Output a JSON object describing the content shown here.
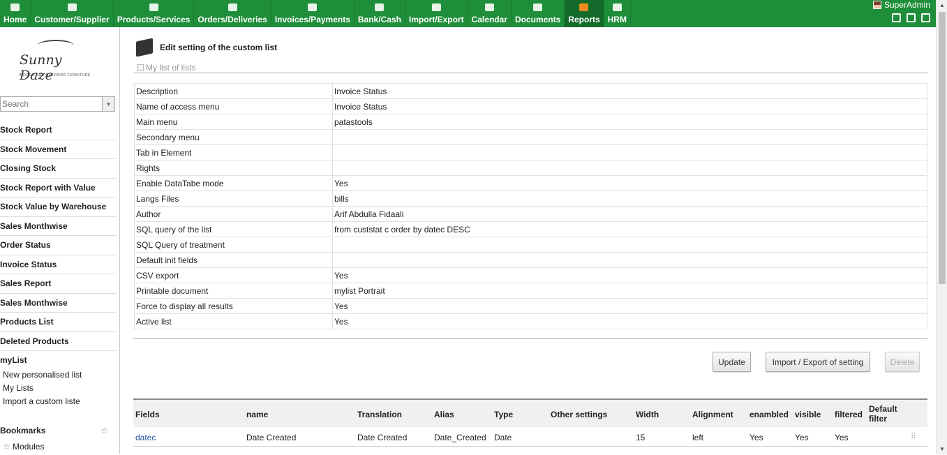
{
  "menu": [
    {
      "label": "Home",
      "icon": "home-icon"
    },
    {
      "label": "Customer/Supplier",
      "icon": "company-icon"
    },
    {
      "label": "Products/Services",
      "icon": "products-icon"
    },
    {
      "label": "Orders/Deliveries",
      "icon": "orders-icon"
    },
    {
      "label": "Invoices/Payments",
      "icon": "invoices-icon"
    },
    {
      "label": "Bank/Cash",
      "icon": "bank-icon"
    },
    {
      "label": "Import/Export",
      "icon": "tools-icon"
    },
    {
      "label": "Calendar",
      "icon": "calendar-icon"
    },
    {
      "label": "Documents",
      "icon": "documents-icon"
    },
    {
      "label": "Reports",
      "icon": "reports-icon",
      "active": true
    },
    {
      "label": "HRM",
      "icon": "hrm-icon"
    }
  ],
  "user": {
    "name": "SuperAdmin"
  },
  "colors": {
    "topbar": "#1f8e3a",
    "active": "#146a2a",
    "link": "#1a4f9c"
  },
  "logo": {
    "text": "Sunny Daze",
    "sub": "INDOOR AND OUTDOOR FURNITURE"
  },
  "search": {
    "placeholder": "Search"
  },
  "sidebar": {
    "items": [
      "Stock Report",
      "Stock Movement",
      "Closing Stock",
      "Stock Report with Value",
      "Stock Value by Warehouse",
      "Sales Monthwise",
      "Order Status",
      "Invoice Status",
      "Sales Report",
      "Sales Monthwise",
      "Products List",
      "Deleted Products"
    ],
    "mylist": {
      "title": "myList",
      "links": [
        "New personalised list",
        "My Lists",
        "Import a custom liste"
      ]
    },
    "bookmarks": {
      "title": "Bookmarks",
      "modules": "Modules"
    }
  },
  "page": {
    "title": "Edit setting of the custom list",
    "mylists_label": "My list of lists",
    "properties": [
      {
        "key": "Description",
        "value": "Invoice Status"
      },
      {
        "key": "Name of access menu",
        "value": "Invoice Status"
      },
      {
        "key": "Main menu",
        "value": "patastools"
      },
      {
        "key": "Secondary menu",
        "value": ""
      },
      {
        "key": "Tab in Element",
        "value": ""
      },
      {
        "key": "Rights",
        "value": ""
      },
      {
        "key": "Enable DataTabe mode",
        "value": "Yes"
      },
      {
        "key": "Langs Files",
        "value": "bills"
      },
      {
        "key": "Author",
        "value": "Arif Abdulla Fidaali"
      },
      {
        "key": "SQL query of the list",
        "value": "from custstat c order by datec DESC"
      },
      {
        "key": "SQL Query of treatment",
        "value": ""
      },
      {
        "key": "Default init fields",
        "value": ""
      },
      {
        "key": "CSV export",
        "value": "Yes"
      },
      {
        "key": "Printable document",
        "value": "mylist Portrait"
      },
      {
        "key": "Force to display all results",
        "value": "Yes"
      },
      {
        "key": "Active list",
        "value": "Yes"
      }
    ],
    "buttons": {
      "update": "Update",
      "import_export": "Import / Export of setting",
      "delete": "Delete"
    }
  },
  "fields_table": {
    "headers": [
      "Fields",
      "name",
      "Translation",
      "Alias",
      "Type",
      "Other settings",
      "Width",
      "Alignment",
      "enambled",
      "visible",
      "filtered",
      "Default filter"
    ],
    "rows": [
      [
        "datec",
        "Date Created",
        "Date Created",
        "Date_Created",
        "Date",
        "",
        "15",
        "left",
        "Yes",
        "Yes",
        "Yes"
      ]
    ]
  }
}
